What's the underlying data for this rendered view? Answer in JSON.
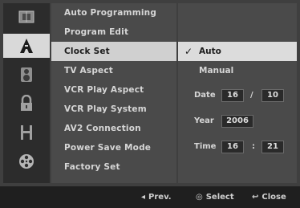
{
  "icons": [
    {
      "name": "disc-menu-icon"
    },
    {
      "name": "setup-a-icon"
    },
    {
      "name": "speaker-icon"
    },
    {
      "name": "lock-icon"
    },
    {
      "name": "film-icon"
    },
    {
      "name": "reel-icon"
    }
  ],
  "menu": {
    "items": [
      {
        "label": "Auto Programming"
      },
      {
        "label": "Program Edit"
      },
      {
        "label": "Clock Set"
      },
      {
        "label": "TV Aspect"
      },
      {
        "label": "VCR Play Aspect"
      },
      {
        "label": "VCR Play System"
      },
      {
        "label": "AV2 Connection"
      },
      {
        "label": "Power Save Mode"
      },
      {
        "label": "Factory Set"
      }
    ],
    "selected_index": 2
  },
  "panel": {
    "check_glyph": "✓",
    "option_auto": "Auto",
    "option_manual": "Manual",
    "date_label": "Date",
    "date_month": "16",
    "date_sep": "/",
    "date_day": "10",
    "year_label": "Year",
    "year_value": "2006",
    "time_label": "Time",
    "time_hour": "16",
    "time_sep": ":",
    "time_minute": "21"
  },
  "footer": {
    "prev_glyph": "◂",
    "prev_label": "Prev.",
    "select_glyph": "◎",
    "select_label": "Select",
    "close_glyph": "↩",
    "close_label": "Close"
  },
  "colors": {
    "background": "#3f3f3f",
    "highlight": "#d0d0d0",
    "text": "#d6d6d6"
  }
}
